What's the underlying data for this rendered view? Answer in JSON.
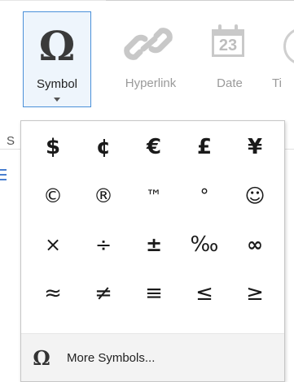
{
  "ribbon": {
    "symbol_button": {
      "glyph": "Ω",
      "label": "Symbol"
    },
    "hyperlink_button": {
      "label": "Hyperlink"
    },
    "date_button": {
      "label": "Date",
      "day": "23"
    },
    "time_button": {
      "label": "Ti"
    },
    "group_label_partial": "S"
  },
  "symbol_menu": {
    "rows": [
      [
        "$",
        "¢",
        "€",
        "£",
        "¥"
      ],
      [
        "©",
        "®",
        "™",
        "°",
        "☺"
      ],
      [
        "×",
        "÷",
        "±",
        "‰",
        "∞"
      ],
      [
        "≈",
        "≠",
        "≡",
        "≤",
        "≥"
      ]
    ],
    "more": {
      "glyph": "Ω",
      "label": "More Symbols..."
    }
  },
  "colors": {
    "accent": "#4a90d9",
    "selected_bg": "#eef5fc",
    "disabled": "#bdbdbd"
  }
}
